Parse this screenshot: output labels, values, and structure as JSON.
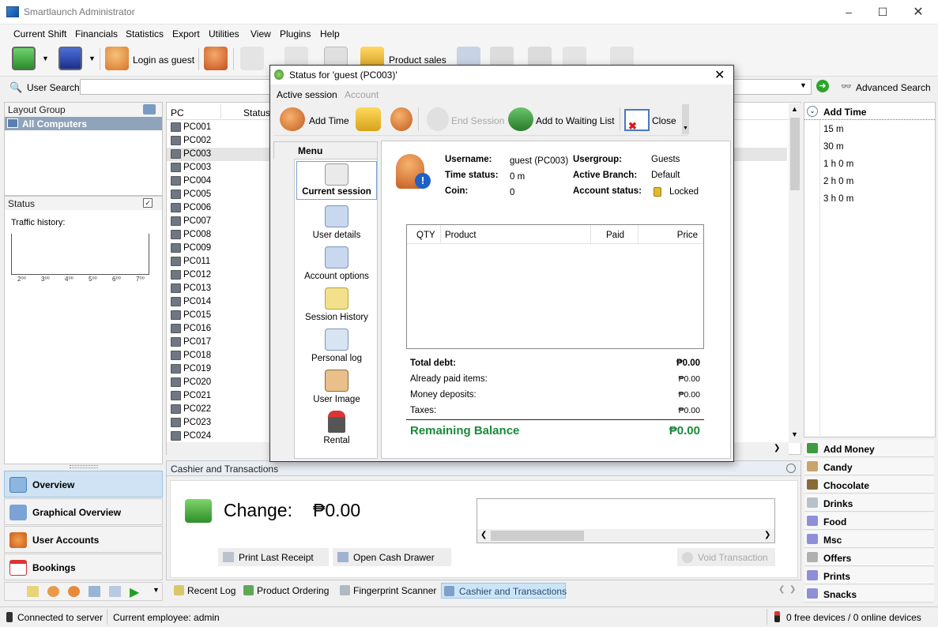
{
  "window": {
    "title": "Smartlaunch Administrator"
  },
  "menubar": [
    "Current Shift",
    "Financials",
    "Statistics",
    "Export",
    "Utilities",
    "View",
    "Plugins",
    "Help"
  ],
  "toolbar": {
    "login_guest": "Login as guest",
    "product_sales": "Product sales"
  },
  "search": {
    "label": "User Search:",
    "advanced": "Advanced Search"
  },
  "layout_group": {
    "header": "Layout Group",
    "item": "All Computers"
  },
  "status_panel": {
    "header": "Status",
    "traffic": "Traffic history:",
    "ticks": [
      "2⁰⁰",
      "3⁰⁰",
      "4⁰⁰",
      "5⁰⁰",
      "6⁰⁰",
      "7⁰⁰"
    ]
  },
  "pc_list": {
    "col_pc": "PC",
    "col_status": "Status",
    "rows": [
      "PC001",
      "PC002",
      "PC003",
      "PC003",
      "PC004",
      "PC005",
      "PC006",
      "PC007",
      "PC008",
      "PC009",
      "PC011",
      "PC012",
      "PC013",
      "PC014",
      "PC015",
      "PC016",
      "PC017",
      "PC018",
      "PC019",
      "PC020",
      "PC021",
      "PC022",
      "PC023",
      "PC024"
    ],
    "selected_index": 2
  },
  "left_nav": [
    "Overview",
    "Graphical Overview",
    "User Accounts",
    "Bookings"
  ],
  "right_panel": {
    "add_time": "Add Time",
    "time_options": [
      "15 m",
      "30 m",
      "1 h 0 m",
      "2 h 0 m",
      "3 h 0 m"
    ],
    "categories": [
      "Add Money",
      "Candy",
      "Chocolate",
      "Drinks",
      "Food",
      "Msc",
      "Offers",
      "Prints",
      "Snacks"
    ]
  },
  "cashier": {
    "header": "Cashier and Transactions",
    "change_label": "Change:",
    "change_value": "₱0.00",
    "print_receipt": "Print Last Receipt",
    "open_drawer": "Open Cash Drawer",
    "void": "Void Transaction"
  },
  "bottom_tabs": [
    "Recent Log",
    "Product Ordering",
    "Fingerprint Scanner",
    "Cashier and Transactions"
  ],
  "statusbar": {
    "connected": "Connected to server",
    "employee": "Current employee: admin",
    "devices": "0 free devices / 0 online devices"
  },
  "dialog": {
    "title": "Status for 'guest (PC003)'",
    "tabs": [
      "Active session",
      "Account"
    ],
    "toolbar": {
      "add_time": "Add Time",
      "end_session": "End Session",
      "add_waiting": "Add to Waiting List",
      "close": "Close"
    },
    "menu_header": "Menu",
    "menu_items": [
      "Current session",
      "User details",
      "Account options",
      "Session History",
      "Personal log",
      "User Image",
      "Rental"
    ],
    "info": {
      "username_label": "Username:",
      "username_value": "guest (PC003)",
      "time_status_label": "Time status:",
      "time_status_value": "0 m",
      "coin_label": "Coin:",
      "coin_value": "0",
      "usergroup_label": "Usergroup:",
      "usergroup_value": "Guests",
      "branch_label": "Active Branch:",
      "branch_value": "Default",
      "account_status_label": "Account status:",
      "account_status_value": "Locked"
    },
    "table_headers": [
      "QTY",
      "Product",
      "Paid",
      "Price"
    ],
    "summary": {
      "total_debt_label": "Total debt:",
      "total_debt_value": "₱0.00",
      "already_paid_label": "Already paid items:",
      "already_paid_value": "₱0.00",
      "deposits_label": "Money deposits:",
      "deposits_value": "₱0.00",
      "taxes_label": "Taxes:",
      "taxes_value": "₱0.00",
      "remaining_label": "Remaining Balance",
      "remaining_value": "₱0.00"
    }
  },
  "colors": {
    "accent_green": "#1a8a3a",
    "selection_blue": "#cce4f7",
    "nav_active": "#cfe3f5"
  }
}
